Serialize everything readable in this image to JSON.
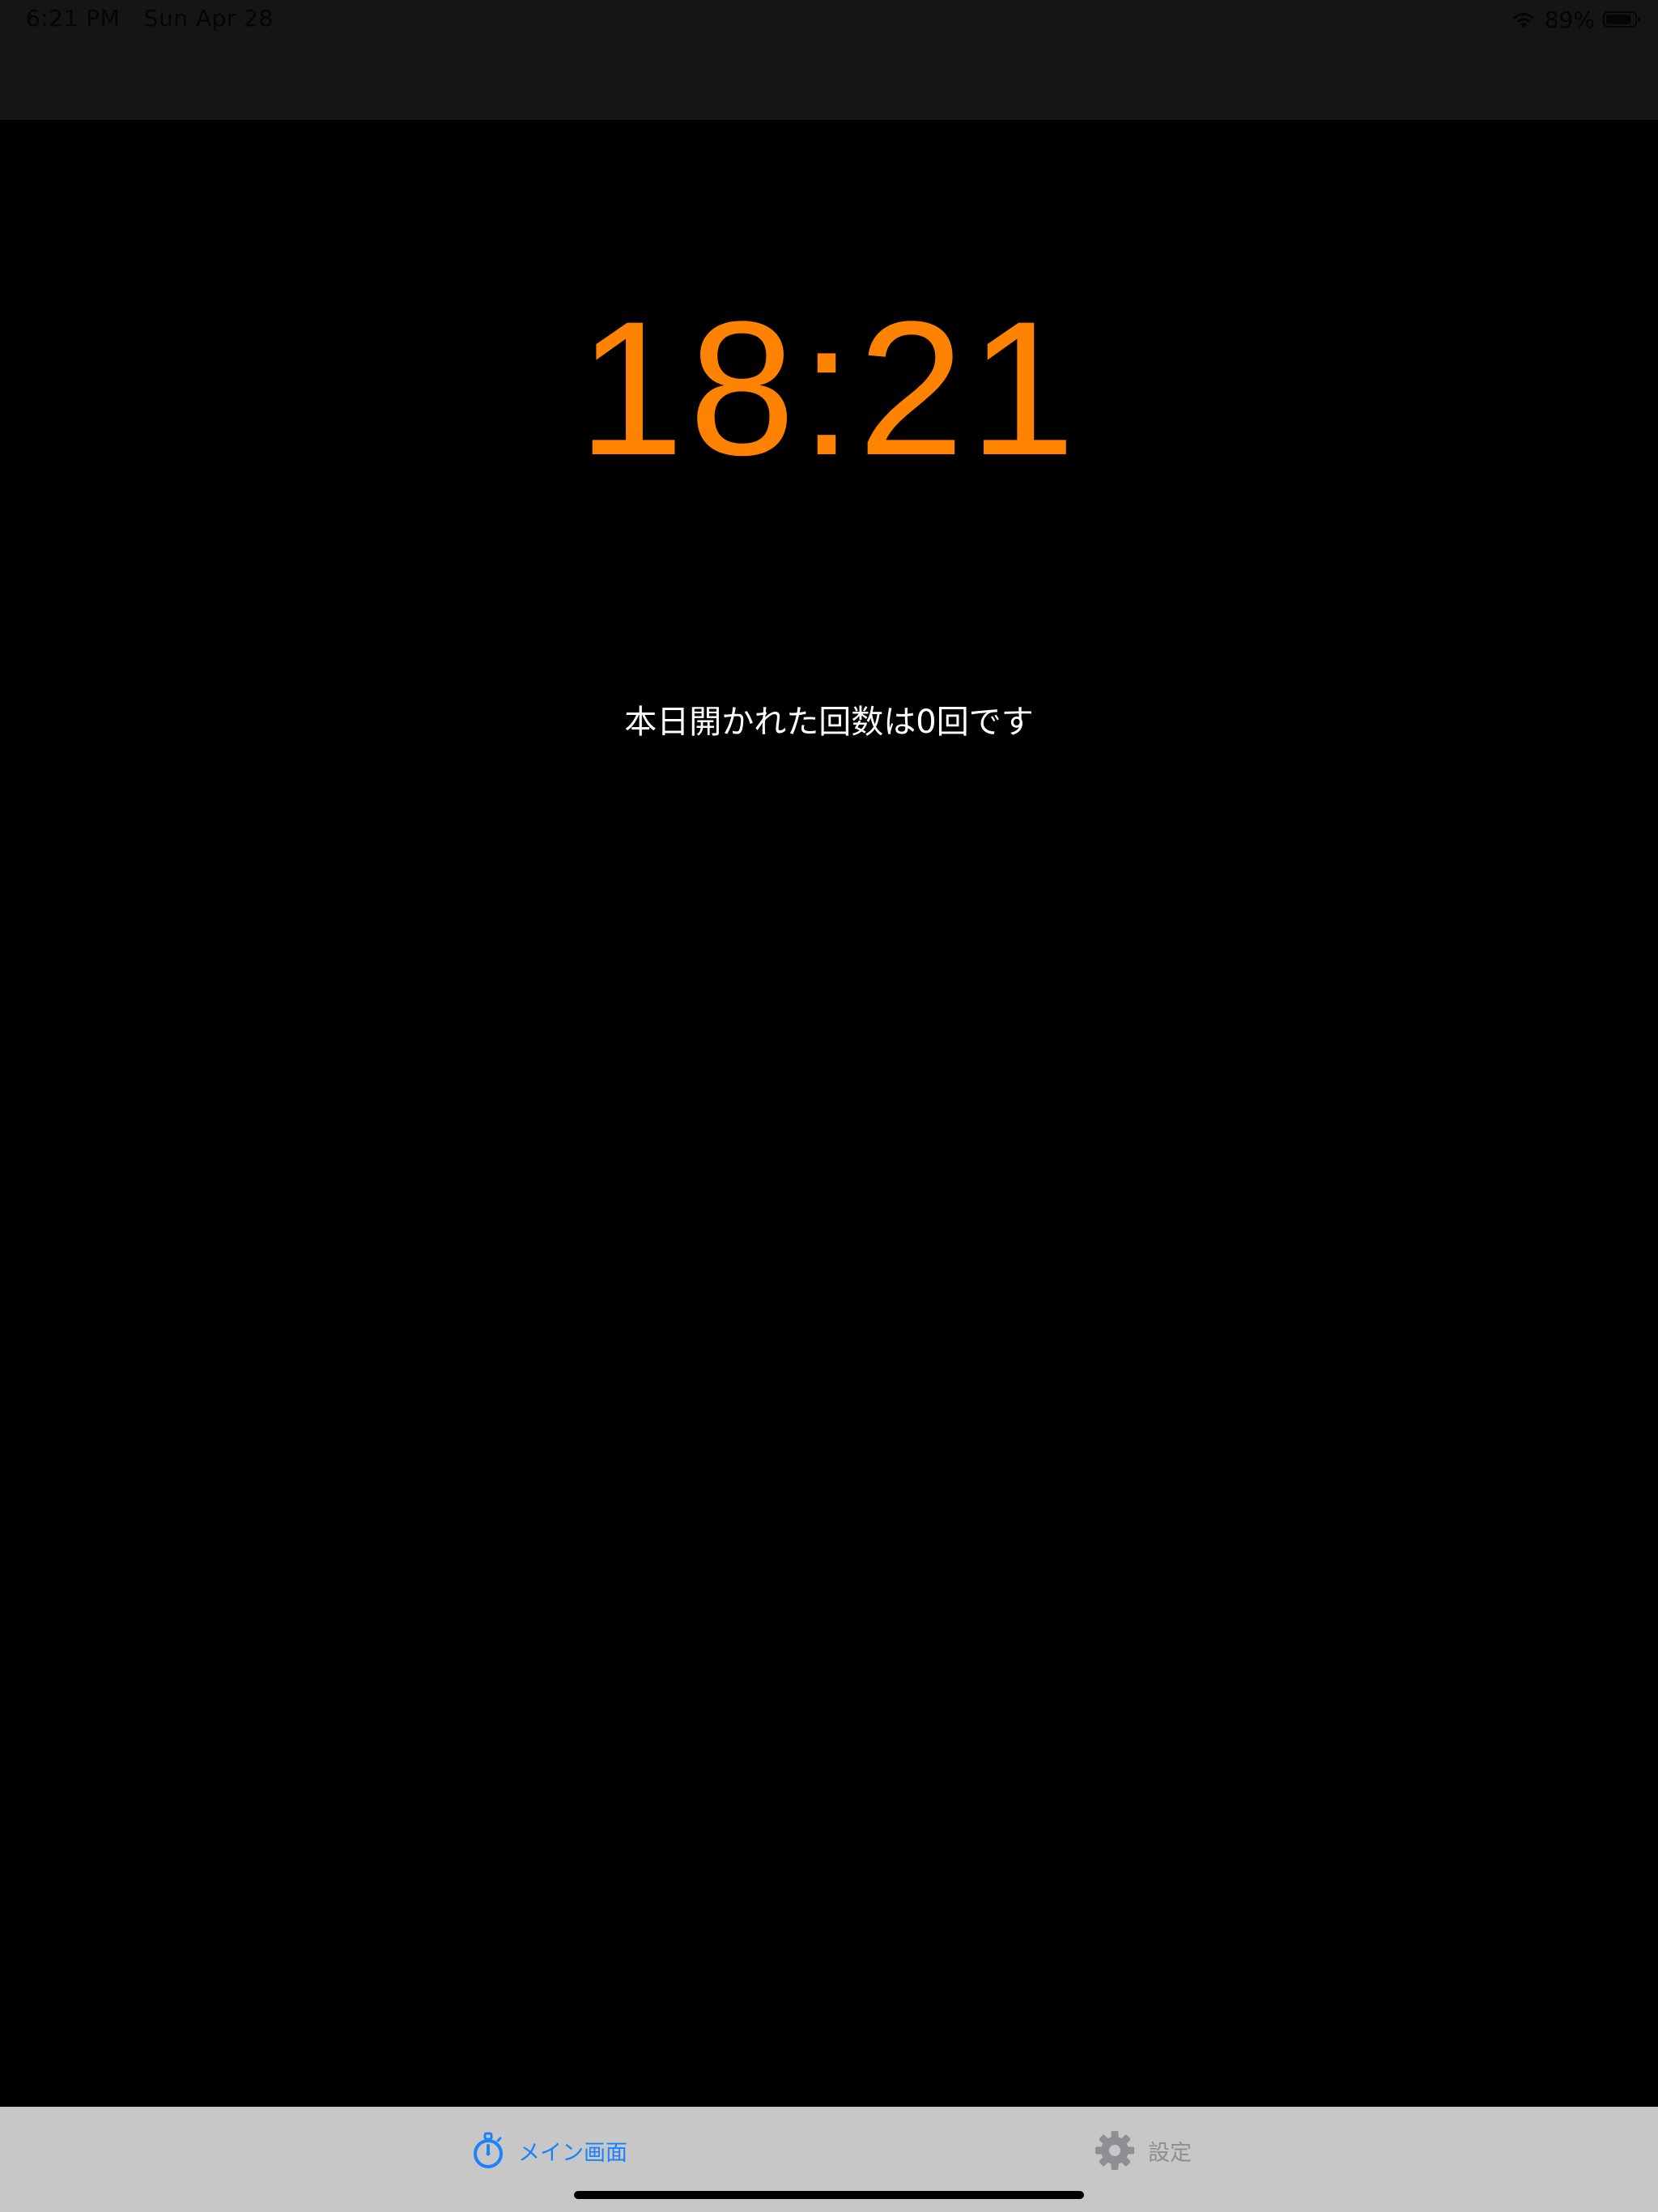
{
  "status_bar": {
    "time": "6:21 PM",
    "date": "Sun Apr 28",
    "battery_percent": "89%",
    "battery_level": 0.89
  },
  "main": {
    "clock": "18:21",
    "open_count_text": "本日開かれた回数は0回です"
  },
  "tab_bar": {
    "tabs": [
      {
        "label": "メイン画面",
        "icon": "stopwatch-icon",
        "selected": true
      },
      {
        "label": "設定",
        "icon": "gear-icon",
        "selected": false
      }
    ],
    "active_color": "#1a82fb",
    "inactive_color": "#8e8e93"
  },
  "colors": {
    "clock": "#ff8200",
    "background": "#000000"
  }
}
